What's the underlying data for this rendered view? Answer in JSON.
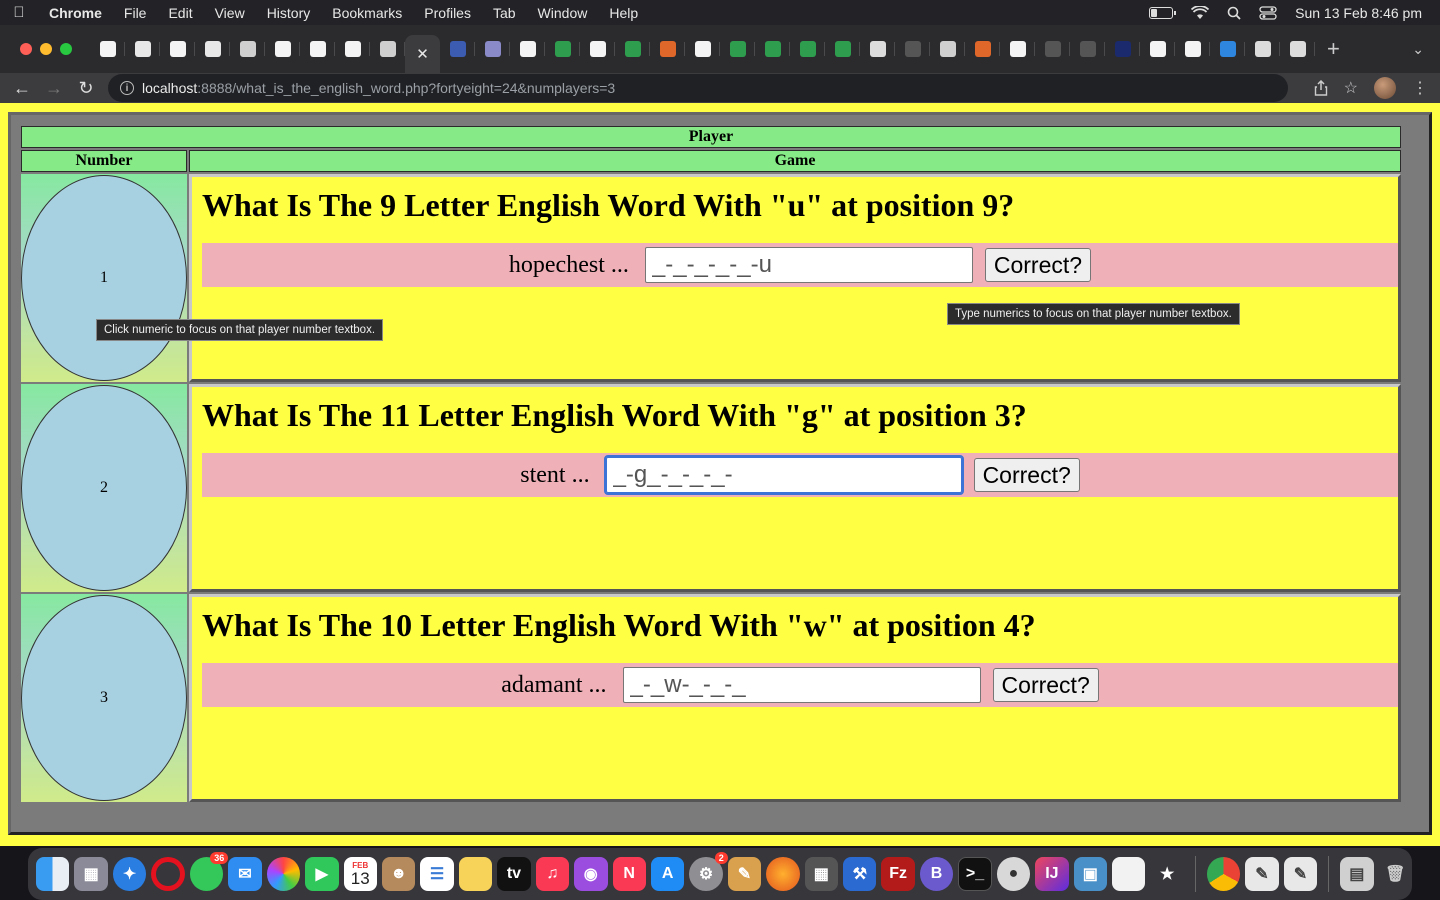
{
  "menubar": {
    "app": "Chrome",
    "items": [
      "File",
      "Edit",
      "View",
      "History",
      "Bookmarks",
      "Profiles",
      "Tab",
      "Window",
      "Help"
    ],
    "clock": "Sun 13 Feb  8:46 pm"
  },
  "browser": {
    "tab_favicons": [
      "#f4f4f4",
      "#e8e8e8",
      "#f4f4f4",
      "#e8e8e8",
      "#cfcfcf",
      "#f4f4f4",
      "#f4f4f4",
      "#f4f4f4",
      "#cfcfcf",
      "active",
      "#3b5cb0",
      "#8a8ac8",
      "#f4f4f4",
      "#2f9d4e",
      "#f4f4f4",
      "#2f9d4e",
      "#e0672a",
      "#f4f4f4",
      "#2f9d4e",
      "#2f9d4e",
      "#2f9d4e",
      "#2f9d4e",
      "#dcdcdc",
      "#555",
      "#cfcfcf",
      "#e0672a",
      "#f4f4f4",
      "#555",
      "#555",
      "#1a2a6c",
      "#f4f4f4",
      "#f4f4f4",
      "#2e86de",
      "#dcdcdc",
      "#dcdcdc"
    ],
    "url_host": "localhost",
    "url_path": ":8888/what_is_the_english_word.php?fortyeight=24&numplayers=3"
  },
  "table": {
    "header_player": "Player",
    "header_number": "Number",
    "header_game": "Game"
  },
  "players": [
    {
      "number": "1",
      "question": "What Is The 9 Letter English Word With \"u\" at position 9?",
      "clue": "hopechest ...",
      "answer_value": "_-_-_-_-_-u",
      "button": "Correct?"
    },
    {
      "number": "2",
      "question": "What Is The 11 Letter English Word With \"g\" at position 3?",
      "clue": "stent ...",
      "answer_value": "_-g_-_-_-_-",
      "button": "Correct?"
    },
    {
      "number": "3",
      "question": "What Is The 10 Letter English Word With \"w\" at position 4?",
      "clue": "adamant ...",
      "answer_value": "_-_w-_-_-_",
      "button": "Correct?"
    }
  ],
  "tooltips": {
    "number": "Click numeric to focus on that player number textbox.",
    "input": "Type numerics to focus on that player number textbox."
  },
  "dock": {
    "messages_badge": "36",
    "settings_badge": "2",
    "calendar_month": "FEB",
    "calendar_day": "13"
  }
}
